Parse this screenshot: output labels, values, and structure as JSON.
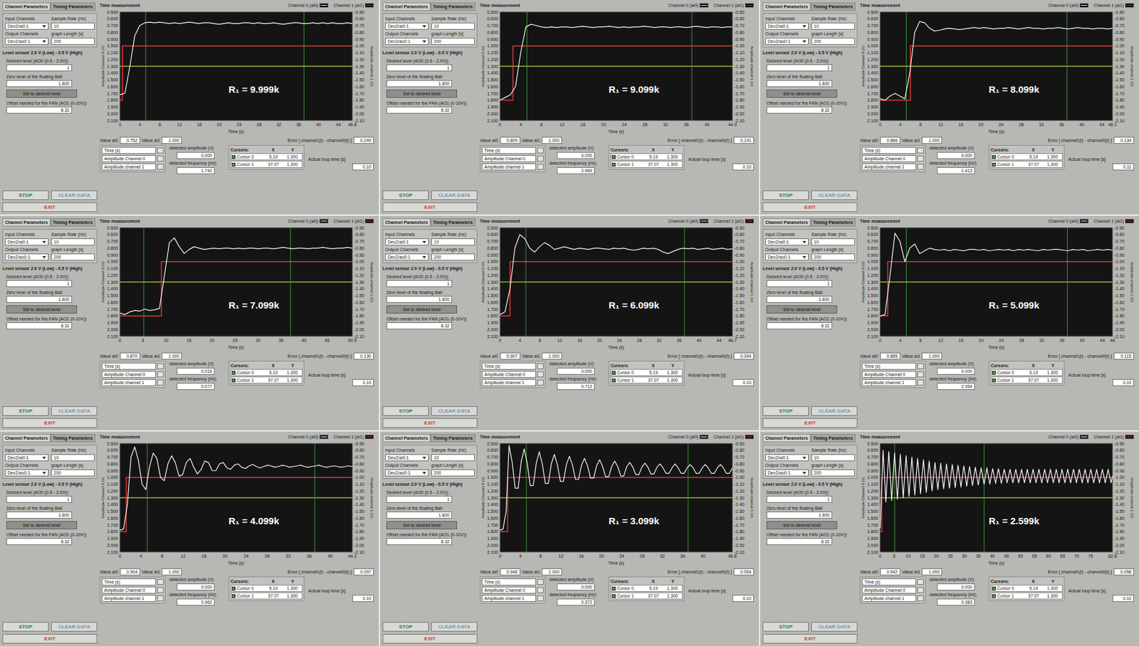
{
  "common": {
    "tabs": [
      {
        "label": "Channel Parameters",
        "selected": true
      },
      {
        "label": "Timing Parameters",
        "selected": false
      }
    ],
    "input_channels": {
      "label": "Input Channels",
      "value": "Dev2/ai0:1"
    },
    "output_channels": {
      "label": "Output Channels",
      "value": "Dev2/ao0:1"
    },
    "sample_rate": {
      "label": "Sample Rate (Hz)",
      "value": "10"
    },
    "graph_length": {
      "label": "graph Length [s]",
      "value": "200"
    },
    "sensor_title": "Level sensor 2.0 V (Low) - 0.5 V (High)",
    "desired_level": {
      "label": "Desired level (AO0 (0.5 - 2.0V))",
      "value": "1"
    },
    "zero_level": {
      "label": "Zero level of the floating Ball",
      "value": "1.800"
    },
    "set_button": "Set to desired level",
    "fan_offset": {
      "label": "Offset needed for the FAN (AO1 (0-10V))",
      "value": "8.32"
    },
    "buttons": [
      {
        "label": "STOP",
        "color": "#2f7d32"
      },
      {
        "label": "CLEAR DATA",
        "color": "#6f93bd"
      },
      {
        "label": "EXIT",
        "color": "#d03a2a"
      }
    ],
    "chart_title": "Time measurement",
    "legend": [
      {
        "label": "Channel 0 (ai0)",
        "color": "#ffffff"
      },
      {
        "label": "Channel 1 (ai1)",
        "color": "#e53935"
      }
    ],
    "y_left_title": "Amplitude Channel 0 (V)",
    "y_right_title": "Amplitude channel 1 (V)",
    "y_left_ticks": [
      "0.500",
      "0.600",
      "0.700",
      "0.800",
      "0.900",
      "1.000",
      "1.100",
      "1.200",
      "1.300",
      "1.400",
      "1.500",
      "1.600",
      "1.700",
      "1.800",
      "1.900",
      "2.000",
      "2.100"
    ],
    "y_right_ticks": [
      "-0.50",
      "-0.60",
      "-0.70",
      "-0.80",
      "-0.90",
      "-1.00",
      "-1.10",
      "-1.20",
      "-1.30",
      "-1.40",
      "-1.50",
      "-1.60",
      "-1.70",
      "-1.80",
      "-1.90",
      "-2.00",
      "-2.10"
    ],
    "x_title": "Time (s)",
    "value_ai0_label": "Value ai0",
    "value_ai1_label": "Value ai1",
    "value_ai1": "1.000",
    "error_label": "Error [ channel1(t) - channel0(t) ]",
    "plot_legend": [
      "Time (s)",
      "Amplitude Channel 0",
      "Amplitude channel 1"
    ],
    "amplitude_label": "detected amplitude (V)",
    "frequency_label": "detected frequency (Hz)",
    "cursors": {
      "title": "Cursors:",
      "headers": [
        "X",
        "Y"
      ],
      "rows": [
        {
          "name": "Cursor 0",
          "x": "5.19",
          "y": "1.300"
        },
        {
          "name": "Cursor 1",
          "x": "37.07",
          "y": "1.300"
        }
      ]
    },
    "loop_time_label": "Actual loop time [s]",
    "setpoint": {
      "before": 1.8,
      "after": 1.0
    }
  },
  "panels": [
    {
      "label": "R₁ = 9.999k",
      "value_ai0": "0.752",
      "error": "0.249",
      "amplitude": "0.000",
      "frequency": "1.742",
      "loop_time": "0.10",
      "x_max": 46.8,
      "step_time": 0.5,
      "x_ticks": [
        "0",
        "4",
        "8",
        "12",
        "16",
        "20",
        "24",
        "28",
        "32",
        "36",
        "40",
        "44",
        "46.8"
      ],
      "channel0": [
        1.72,
        1.7,
        1.3,
        0.85,
        0.7,
        0.66,
        0.65,
        0.66,
        0.65,
        0.66,
        0.67,
        0.66,
        0.67,
        0.66,
        0.65,
        0.66,
        0.67,
        0.66,
        0.66,
        0.67,
        0.68,
        0.67,
        0.66,
        0.67,
        0.67,
        0.66,
        0.66,
        0.67,
        0.66,
        0.67,
        0.67,
        0.66,
        0.67,
        0.68,
        0.67,
        0.66,
        0.66,
        0.67,
        0.67,
        0.66,
        0.67,
        0.66,
        0.67,
        0.66,
        0.67,
        0.67,
        0.66,
        0.67
      ]
    },
    {
      "label": "R₁ = 9.099k",
      "value_ai0": "0.809",
      "error": "0.191",
      "amplitude": "0.000",
      "frequency": "2.969",
      "loop_time": "0.10",
      "x_max": 44.9,
      "step_time": 2.5,
      "x_ticks": [
        "0",
        "4",
        "8",
        "12",
        "16",
        "20",
        "24",
        "28",
        "32",
        "36",
        "40",
        "44.9"
      ],
      "channel0": [
        1.8,
        1.76,
        1.72,
        1.6,
        1.1,
        0.72,
        0.68,
        0.7,
        0.72,
        0.73,
        0.72,
        0.73,
        0.72,
        0.72,
        0.73,
        0.72,
        0.71,
        0.72,
        0.73,
        0.72,
        0.72,
        0.71,
        0.72,
        0.73,
        0.72,
        0.73,
        0.72,
        0.72,
        0.71,
        0.72,
        0.73,
        0.72,
        0.72,
        0.73,
        0.72,
        0.72,
        0.73,
        0.72,
        0.71,
        0.72,
        0.73,
        0.72,
        0.72,
        0.73,
        0.72,
        0.72
      ]
    },
    {
      "label": "R₁ = 8.099k",
      "value_ai0": "0.866",
      "error": "0.134",
      "amplitude": "0.000",
      "frequency": "1.413",
      "loop_time": "0.11",
      "x_max": 46.1,
      "step_time": 6,
      "x_ticks": [
        "0",
        "4",
        "8",
        "12",
        "16",
        "20",
        "24",
        "28",
        "32",
        "36",
        "40",
        "44",
        "46.1"
      ],
      "channel0": [
        1.78,
        1.8,
        1.74,
        1.7,
        1.74,
        1.78,
        1.4,
        0.8,
        0.64,
        0.66,
        0.74,
        0.78,
        0.77,
        0.75,
        0.74,
        0.75,
        0.76,
        0.75,
        0.74,
        0.73,
        0.74,
        0.73,
        0.74,
        0.75,
        0.74,
        0.74,
        0.73,
        0.74,
        0.75,
        0.74,
        0.73,
        0.74,
        0.74,
        0.75,
        0.74,
        0.74,
        0.73,
        0.74,
        0.75,
        0.74,
        0.73,
        0.74,
        0.74,
        0.75,
        0.74,
        0.74,
        0.75,
        0.74
      ]
    },
    {
      "label": "R₁ = 7.099k",
      "value_ai0": "0.870",
      "error": "0.130",
      "amplitude": "0.016",
      "frequency": "0.077",
      "loop_time": "0.10",
      "x_max": 50.5,
      "step_time": 9,
      "x_ticks": [
        "0",
        "5",
        "10",
        "15",
        "20",
        "25",
        "30",
        "35",
        "40",
        "45",
        "50.5"
      ],
      "channel0": [
        1.76,
        1.78,
        1.74,
        1.72,
        1.73,
        1.7,
        1.72,
        1.71,
        1.69,
        1.2,
        0.72,
        0.65,
        0.78,
        0.88,
        0.82,
        0.78,
        0.8,
        0.82,
        0.81,
        0.8,
        0.81,
        0.8,
        0.8,
        0.81,
        0.8,
        0.81,
        0.8,
        0.8,
        0.81,
        0.8,
        0.8,
        0.81,
        0.8,
        0.79,
        0.8,
        0.81,
        0.8,
        0.8,
        0.81,
        0.8,
        0.8,
        0.79,
        0.8,
        0.81,
        0.8,
        0.8,
        0.79,
        0.8
      ]
    },
    {
      "label": "R₁ = 6.099k",
      "value_ai0": "0.907",
      "error": "0.094",
      "amplitude": "0.000",
      "frequency": "0.712",
      "loop_time": "0.10",
      "x_max": 46.7,
      "step_time": 2,
      "x_ticks": [
        "0",
        "4",
        "8",
        "12",
        "16",
        "20",
        "24",
        "28",
        "32",
        "36",
        "40",
        "44",
        "46.7"
      ],
      "channel0": [
        1.78,
        1.74,
        1.4,
        0.8,
        0.6,
        0.66,
        0.8,
        0.86,
        0.78,
        0.72,
        0.76,
        0.82,
        0.8,
        0.78,
        0.8,
        0.82,
        0.8,
        0.81,
        0.82,
        0.8,
        0.8,
        0.81,
        0.82,
        0.8,
        0.81,
        0.8,
        0.82,
        0.83,
        0.82,
        0.8,
        0.81,
        0.8,
        0.82,
        0.86,
        0.88,
        0.85,
        0.82,
        0.8,
        0.81,
        0.8,
        0.82,
        0.81,
        0.8,
        0.82,
        0.81,
        0.8,
        0.82,
        0.81
      ]
    },
    {
      "label": "R₁ = 5.099k",
      "value_ai0": "0.885",
      "error": "0.115",
      "amplitude": "0.000",
      "frequency": "2.954",
      "loop_time": "0.10",
      "x_max": 46,
      "step_time": 1.5,
      "x_ticks": [
        "0",
        "4",
        "8",
        "12",
        "16",
        "20",
        "24",
        "28",
        "32",
        "36",
        "40",
        "44",
        "46"
      ],
      "channel0": [
        1.8,
        1.78,
        1.2,
        0.58,
        0.7,
        1.0,
        0.8,
        0.74,
        0.88,
        0.84,
        0.8,
        0.82,
        0.83,
        0.82,
        0.84,
        0.82,
        0.83,
        0.84,
        0.82,
        0.82,
        0.83,
        0.82,
        0.84,
        0.83,
        0.82,
        0.83,
        0.82,
        0.84,
        0.82,
        0.83,
        0.82,
        0.83,
        0.84,
        0.82,
        0.83,
        0.82,
        0.82,
        0.83,
        0.84,
        0.82,
        0.83,
        0.82,
        0.84,
        0.83,
        0.82,
        0.83,
        0.82,
        0.83
      ]
    },
    {
      "label": "R₁ = 4.099k",
      "value_ai0": "0.904",
      "error": "0.097",
      "amplitude": "0.000",
      "frequency": "0.962",
      "loop_time": "0.10",
      "x_max": 44.2,
      "step_time": 1.2,
      "x_ticks": [
        "0",
        "4",
        "8",
        "12",
        "16",
        "20",
        "24",
        "28",
        "32",
        "36",
        "40",
        "44.2"
      ],
      "channel0": [
        1.78,
        1.76,
        1.4,
        0.7,
        0.55,
        0.75,
        1.1,
        1.18,
        0.85,
        0.64,
        0.72,
        1.0,
        1.05,
        0.8,
        0.68,
        0.78,
        0.98,
        0.96,
        0.78,
        0.72,
        0.85,
        0.95,
        0.88,
        0.76,
        0.78,
        0.9,
        0.9,
        0.8,
        0.78,
        0.86,
        0.88,
        0.82,
        0.8,
        0.85,
        0.87,
        0.83,
        0.81,
        0.84,
        0.86,
        0.84,
        0.82,
        0.83,
        0.85,
        0.84,
        0.82,
        0.83,
        0.85,
        0.84,
        0.83,
        0.82,
        0.84,
        0.85,
        0.84,
        0.83,
        0.82,
        0.84,
        0.85,
        0.84,
        0.83,
        0.84,
        0.85,
        0.84,
        0.83,
        0.84
      ]
    },
    {
      "label": "R₁ = 3.099k",
      "value_ai0": "0.946",
      "error": "0.054",
      "amplitude": "0.000",
      "frequency": "0.372",
      "loop_time": "0.10",
      "x_max": 45.8,
      "step_time": 1.5,
      "x_ticks": [
        "0",
        "4",
        "8",
        "12",
        "16",
        "20",
        "24",
        "28",
        "32",
        "36",
        "40",
        "45.8"
      ],
      "channel0": [
        1.78,
        1.76,
        1.5,
        0.53,
        0.77,
        1.16,
        1.16,
        0.77,
        0.58,
        0.79,
        1.12,
        1.12,
        0.79,
        0.62,
        0.8,
        1.09,
        1.09,
        0.8,
        0.66,
        0.81,
        1.06,
        1.06,
        0.81,
        0.69,
        0.82,
        1.03,
        1.03,
        0.82,
        0.72,
        0.83,
        1.01,
        1.01,
        0.83,
        0.74,
        0.84,
        0.99,
        0.99,
        0.84,
        0.76,
        0.84,
        0.98,
        0.98,
        0.84,
        0.78,
        0.85,
        0.96,
        0.96,
        0.85,
        0.79,
        0.85,
        0.95,
        0.95,
        0.85,
        0.8,
        0.86,
        0.94,
        0.94,
        0.86,
        0.8,
        0.86,
        0.94,
        0.94,
        0.86,
        0.81,
        0.86,
        0.94,
        0.94,
        0.86,
        0.81,
        0.86,
        0.94,
        0.94,
        0.86,
        0.81,
        0.86,
        0.94,
        0.94,
        0.86
      ]
    },
    {
      "label": "R₁ = 2.599k",
      "value_ai0": "0.942",
      "error": "0.058",
      "amplitude": "0.000",
      "frequency": "0.383",
      "loop_time": "0.10",
      "x_max": 82.8,
      "step_time": 0.6,
      "x_ticks": [
        "0",
        "5",
        "10",
        "15",
        "20",
        "25",
        "30",
        "35",
        "40",
        "45",
        "50",
        "55",
        "60",
        "65",
        "70",
        "75",
        "82.8"
      ],
      "channel0": [
        1.75,
        1.2,
        0.6,
        0.98,
        1.36,
        0.98,
        0.62,
        0.98,
        1.34,
        0.98,
        0.64,
        0.98,
        1.32,
        0.98,
        0.66,
        0.98,
        1.3,
        0.98,
        0.68,
        0.98,
        1.28,
        0.98,
        0.7,
        0.98,
        1.26,
        0.98,
        0.72,
        0.98,
        1.24,
        0.98,
        0.74,
        0.98,
        1.22,
        0.98,
        0.76,
        0.98,
        1.2,
        0.98,
        0.78,
        0.98,
        1.18,
        0.98,
        0.79,
        0.98,
        1.17,
        0.98,
        0.8,
        0.98,
        1.16,
        0.98,
        0.81,
        0.98,
        1.15,
        0.98,
        0.82,
        0.98,
        1.14,
        0.98,
        0.83,
        0.98,
        1.13,
        0.98,
        0.84,
        0.98,
        1.12,
        0.98,
        0.85,
        0.98,
        1.11,
        0.98,
        0.86,
        0.98,
        1.1,
        0.98,
        0.86,
        0.98,
        1.1,
        0.98,
        0.87,
        0.98,
        1.09,
        0.98,
        0.87,
        0.98,
        1.09,
        0.98,
        0.88,
        0.98,
        1.08,
        0.98,
        0.88,
        0.98,
        1.08,
        0.98,
        0.88,
        0.98,
        1.08,
        0.98,
        0.88,
        0.98,
        1.08,
        0.98,
        0.88,
        0.98,
        1.08,
        0.98,
        0.88,
        0.98,
        1.08,
        0.98,
        0.88,
        0.98,
        1.08,
        0.98,
        0.88,
        0.98,
        1.08,
        0.98,
        0.88,
        0.98,
        1.08,
        0.98,
        0.88,
        0.98,
        1.08,
        0.98,
        0.88,
        0.98,
        1.08,
        0.98,
        0.88,
        0.98,
        1.08,
        0.98,
        0.88,
        0.98,
        1.08,
        0.98,
        0.88,
        0.98,
        1.08,
        0.98,
        0.88,
        0.98,
        1.08,
        0.98,
        0.88,
        0.98,
        1.08,
        0.98,
        0.88,
        0.98,
        1.08,
        0.98,
        0.88,
        0.98,
        1.08,
        0.98,
        0.88,
        0.98,
        1.08,
        0.98
      ]
    }
  ]
}
